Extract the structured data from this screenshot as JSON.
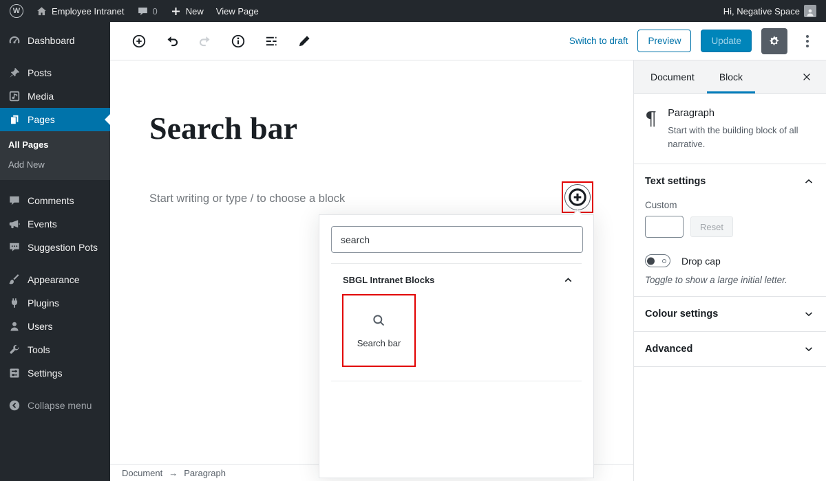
{
  "admin_bar": {
    "wp_logo_letter": "W",
    "site_name": "Employee Intranet",
    "comment_count": "0",
    "new_label": "New",
    "view_page_label": "View Page",
    "greeting": "Hi, Negative Space"
  },
  "sidebar": {
    "items": [
      {
        "label": "Dashboard"
      },
      {
        "label": "Posts"
      },
      {
        "label": "Media"
      },
      {
        "label": "Pages"
      },
      {
        "label": "Comments"
      },
      {
        "label": "Events"
      },
      {
        "label": "Suggestion Pots"
      },
      {
        "label": "Appearance"
      },
      {
        "label": "Plugins"
      },
      {
        "label": "Users"
      },
      {
        "label": "Tools"
      },
      {
        "label": "Settings"
      },
      {
        "label": "Collapse menu"
      }
    ],
    "pages_submenu": {
      "all_pages": "All Pages",
      "add_new": "Add New"
    },
    "active_item": "Pages"
  },
  "editor_header": {
    "switch_to_draft": "Switch to draft",
    "preview": "Preview",
    "update": "Update"
  },
  "canvas": {
    "title": "Search bar",
    "body_placeholder": "Start writing or type / to choose a block"
  },
  "inserter_popup": {
    "search_value": "search",
    "section_title": "SBGL Intranet Blocks",
    "block_label": "Search bar"
  },
  "right_sidebar": {
    "tabs": [
      {
        "label": "Document",
        "active": false
      },
      {
        "label": "Block",
        "active": true
      }
    ],
    "block_card": {
      "title": "Paragraph",
      "description": "Start with the building block of all narrative."
    },
    "text_settings": {
      "title": "Text settings",
      "custom_label": "Custom",
      "custom_value": "",
      "reset_label": "Reset",
      "drop_cap_label": "Drop cap",
      "drop_cap_help": "Toggle to show a large initial letter.",
      "drop_cap_on": false
    },
    "colour_settings_title": "Colour settings",
    "advanced_title": "Advanced"
  },
  "footer": {
    "breadcrumb_root": "Document",
    "breadcrumb_separator": "→",
    "breadcrumb_current": "Paragraph"
  },
  "colors": {
    "admin_bar_bg": "#23282d",
    "active_menu_blue": "#0073aa",
    "primary_button_blue": "#0085ba",
    "tab_underline_blue": "#007cba",
    "annotation_red": "#e20000",
    "border_gray": "#e2e4e7"
  }
}
